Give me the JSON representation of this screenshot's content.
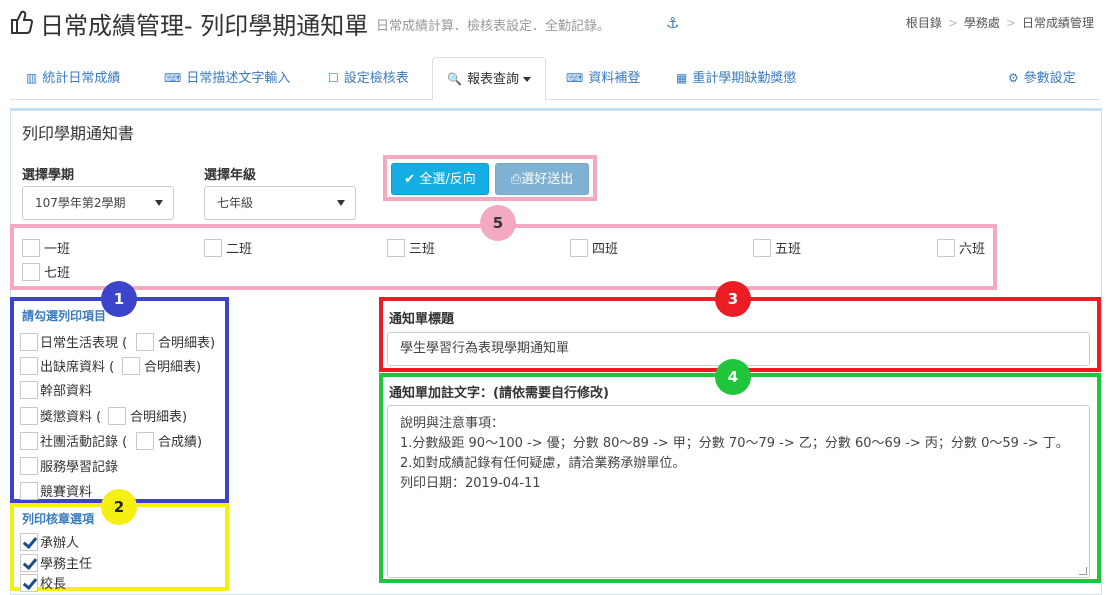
{
  "header": {
    "title": "日常成績管理- 列印學期通知單",
    "subtitle": "日常成績計算．檢核表設定．全勤記錄。",
    "anchor_glyph": "⚓",
    "breadcrumb": [
      "根目錄",
      "學務處",
      "日常成績管理"
    ]
  },
  "tabs": [
    {
      "icon": "bar-chart-icon",
      "glyph": "▥",
      "label": "統計日常成績"
    },
    {
      "icon": "keyboard-icon",
      "glyph": "⌨",
      "label": "日常描述文字輸入"
    },
    {
      "icon": "square-icon",
      "glyph": "☐",
      "label": "設定檢核表"
    },
    {
      "icon": "search-icon",
      "glyph": "🔍",
      "label": "報表查詢",
      "active": true
    },
    {
      "icon": "keyboard-icon",
      "glyph": "⌨",
      "label": "資料補登"
    },
    {
      "icon": "calculator-icon",
      "glyph": "▦",
      "label": "重計學期缺勤獎懲"
    },
    {
      "icon": "gear-icon",
      "glyph": "⚙",
      "label": "參數設定"
    }
  ],
  "panel": {
    "title": "列印學期通知書",
    "semester_label": "選擇學期",
    "semester_value": "107學年第2學期",
    "grade_label": "選擇年級",
    "grade_value": "七年級",
    "select_all_button": "全選/反向",
    "submit_button": "選好送出",
    "check_glyph": "✔",
    "print_glyph": "⎙"
  },
  "classes": [
    "一班",
    "二班",
    "三班",
    "四班",
    "五班",
    "六班",
    "七班"
  ],
  "print_items": {
    "heading": "請勾選列印項目",
    "items": [
      {
        "label": "日常生活表現 (",
        "sub": "合明細表)"
      },
      {
        "label": "出缺席資料 (",
        "sub": "合明細表)"
      },
      {
        "label": "幹部資料"
      },
      {
        "label": "獎懲資料 (",
        "sub": "合明細表)"
      },
      {
        "label": "社團活動記錄 (",
        "sub": "合成績)"
      },
      {
        "label": "服務學習記錄"
      },
      {
        "label": "競賽資料"
      }
    ]
  },
  "stamp_options": {
    "heading": "列印核章選項",
    "items": [
      {
        "label": "承辦人",
        "checked": true
      },
      {
        "label": "學務主任",
        "checked": true
      },
      {
        "label": "校長",
        "checked": true
      }
    ]
  },
  "notice_title": {
    "label": "通知單標題",
    "value": "學生學習行為表現學期通知單"
  },
  "notice_note": {
    "label": "通知單加註文字：(請依需要自行修改)",
    "lines": [
      "說明與注意事項：",
      "1.分數級距 90～100 -> 優；分數 80～89 -> 甲；分數 70～79 -> 乙；分數 60～69 -> 丙；分數 0～59 -> 丁。",
      "2.如對成績記錄有任何疑慮，請洽業務承辦單位。",
      "列印日期：2019-04-11"
    ]
  },
  "badges": [
    "1",
    "2",
    "3",
    "4",
    "5"
  ],
  "colors": {
    "pink": "#f4a9c3",
    "blue": "#3c45c9",
    "yellow": "#f6ef12",
    "red": "#ec1c24",
    "green": "#1fc53b",
    "link": "#3a7bbf",
    "primary": "#15aee2"
  }
}
